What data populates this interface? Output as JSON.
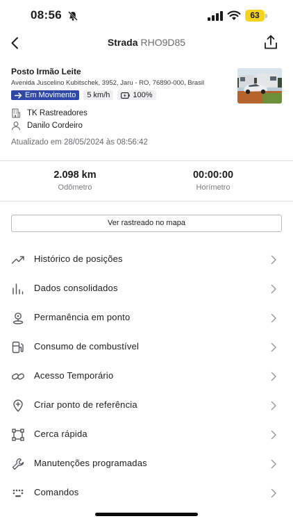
{
  "status_bar": {
    "time": "08:56",
    "battery": "63",
    "battery_color": "#f6d21d"
  },
  "header": {
    "model": "Strada",
    "plate": "RHO9D85"
  },
  "vehicle": {
    "place": "Posto Irmão Leite",
    "address": "Avenida Juscelino Kubitschek, 3952, Jaru - RO, 76890-000, Brasil",
    "status_label": "Em Movimento",
    "status_color": "#2f48a7",
    "speed": "5 km/h",
    "battery_level": "100%",
    "company": "TK Rastreadores",
    "driver": "Danilo Cordeiro",
    "updated": "Atualizado em 28/05/2024 às 08:56:42"
  },
  "stats": {
    "odometer_value": "2.098 km",
    "odometer_label": "Odômetro",
    "hourmeter_value": "00:00:00",
    "hourmeter_label": "Horímetro"
  },
  "map_button": "Ver rastreado no mapa",
  "menu": [
    {
      "label": "Histórico de posições",
      "icon": "trending-up-icon"
    },
    {
      "label": "Dados consolidados",
      "icon": "bar-chart-icon"
    },
    {
      "label": "Permanência em ponto",
      "icon": "map-pin-icon"
    },
    {
      "label": "Consumo de combustível",
      "icon": "fuel-icon"
    },
    {
      "label": "Acesso Temporário",
      "icon": "link-icon"
    },
    {
      "label": "Criar ponto de referência",
      "icon": "add-location-icon"
    },
    {
      "label": "Cerca rápida",
      "icon": "fence-icon"
    },
    {
      "label": "Manutenções programadas",
      "icon": "wrench-icon"
    },
    {
      "label": "Comandos",
      "icon": "keypad-icon"
    }
  ]
}
